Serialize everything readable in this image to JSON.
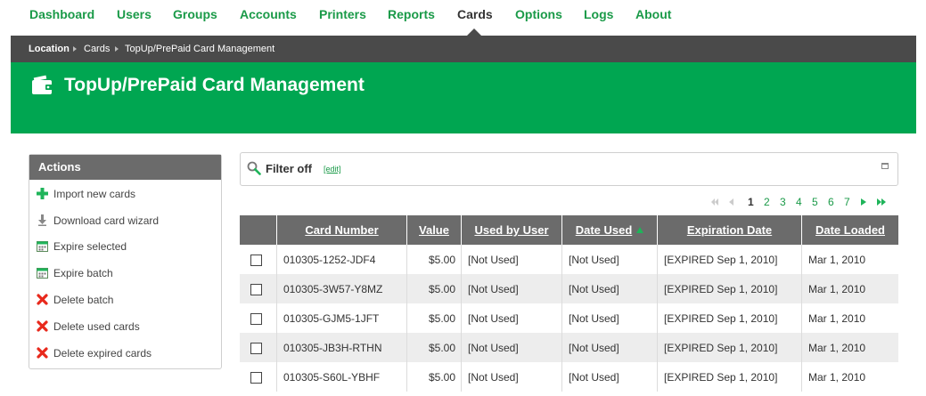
{
  "nav": {
    "items": [
      {
        "label": "Dashboard"
      },
      {
        "label": "Users"
      },
      {
        "label": "Groups"
      },
      {
        "label": "Accounts"
      },
      {
        "label": "Printers"
      },
      {
        "label": "Reports"
      },
      {
        "label": "Cards"
      },
      {
        "label": "Options"
      },
      {
        "label": "Logs"
      },
      {
        "label": "About"
      }
    ],
    "active": "Cards",
    "color": "#1a9a48"
  },
  "breadcrumb": [
    "Location",
    "Cards",
    "TopUp/PrePaid Card Management"
  ],
  "header": {
    "title": "TopUp/PrePaid Card Management",
    "icon": "wallet-icon",
    "color": "#00a651"
  },
  "actions": {
    "title": "Actions",
    "items": [
      {
        "label": "Import new cards",
        "icon": "plus-icon"
      },
      {
        "label": "Download card wizard",
        "icon": "download-icon"
      },
      {
        "label": "Expire selected",
        "icon": "calendar-icon"
      },
      {
        "label": "Expire batch",
        "icon": "calendar-icon"
      },
      {
        "label": "Delete batch",
        "icon": "delete-x-icon"
      },
      {
        "label": "Delete used cards",
        "icon": "delete-x-icon"
      },
      {
        "label": "Delete expired cards",
        "icon": "delete-x-icon"
      }
    ]
  },
  "filter": {
    "label": "Filter off",
    "edit_link": "[edit]"
  },
  "pagination": {
    "pages": [
      "1",
      "2",
      "3",
      "4",
      "5",
      "6",
      "7"
    ],
    "current": "1"
  },
  "table": {
    "columns": [
      "Card Number",
      "Value",
      "Used by User",
      "Date Used",
      "Expiration Date",
      "Date Loaded"
    ],
    "sorted_by": "Date Used",
    "rows": [
      [
        "010305-1252-JDF4",
        "$5.00",
        "[Not Used]",
        "[Not Used]",
        "[EXPIRED Sep 1, 2010]",
        "Mar 1, 2010"
      ],
      [
        "010305-3W57-Y8MZ",
        "$5.00",
        "[Not Used]",
        "[Not Used]",
        "[EXPIRED Sep 1, 2010]",
        "Mar 1, 2010"
      ],
      [
        "010305-GJM5-1JFT",
        "$5.00",
        "[Not Used]",
        "[Not Used]",
        "[EXPIRED Sep 1, 2010]",
        "Mar 1, 2010"
      ],
      [
        "010305-JB3H-RTHN",
        "$5.00",
        "[Not Used]",
        "[Not Used]",
        "[EXPIRED Sep 1, 2010]",
        "Mar 1, 2010"
      ],
      [
        "010305-S60L-YBHF",
        "$5.00",
        "[Not Used]",
        "[Not Used]",
        "[EXPIRED Sep 1, 2010]",
        "Mar 1, 2010"
      ]
    ]
  }
}
